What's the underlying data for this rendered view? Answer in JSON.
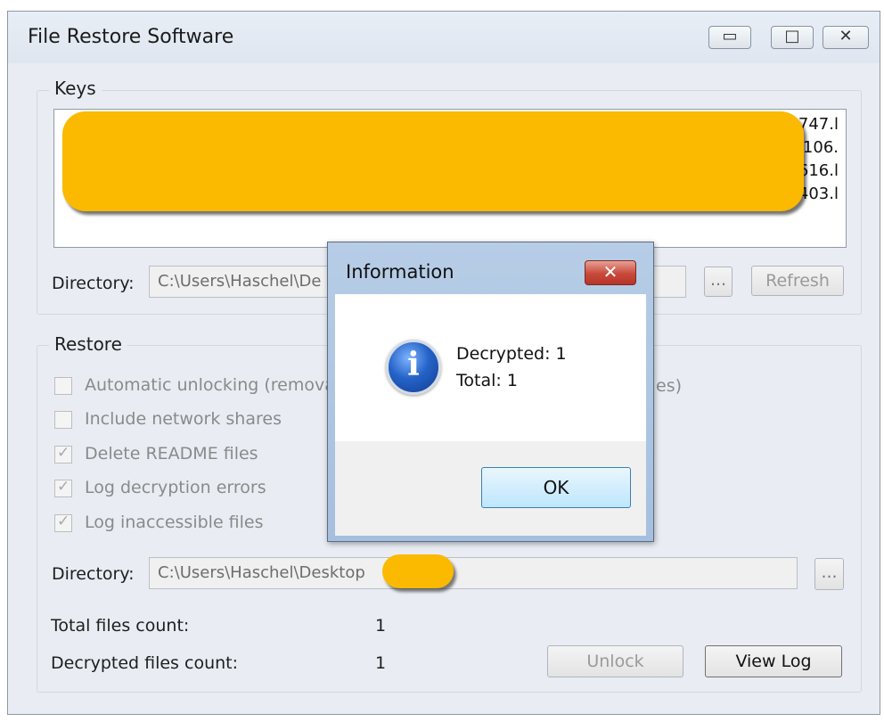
{
  "window": {
    "title": "File Restore Software",
    "minimize_glyph": "▭",
    "maximize_glyph": "□",
    "close_glyph": "✕"
  },
  "keys": {
    "legend": "Keys",
    "list_rows": [
      "747.l",
      "7106.",
      "616.l",
      "403.l"
    ],
    "directory_label": "Directory:",
    "directory_value": "C:\\Users\\Haschel\\De",
    "browse_label": "...",
    "refresh_label": "Refresh"
  },
  "restore": {
    "legend": "Restore",
    "options": [
      {
        "label": "Automatic unlocking (remova",
        "checked": false
      },
      {
        "label": "Include network shares",
        "checked": false
      },
      {
        "label": "Delete README files",
        "checked": true
      },
      {
        "label": "Log decryption errors",
        "checked": true
      },
      {
        "label": "Log inaccessible files",
        "checked": true
      }
    ],
    "option0_tail": "es)",
    "directory_label": "Directory:",
    "directory_value": "C:\\Users\\Haschel\\Desktop",
    "browse_label": "...",
    "total_label": "Total files count:",
    "total_value": "1",
    "decrypted_label": "Decrypted files count:",
    "decrypted_value": "1",
    "unlock_label": "Unlock",
    "view_log_label": "View Log"
  },
  "dialog": {
    "title": "Information",
    "close_glyph": "✕",
    "icon": "information-icon",
    "icon_glyph": "i",
    "line1": "Decrypted: 1",
    "line2": "Total: 1",
    "ok_label": "OK"
  },
  "colors": {
    "redaction": "#fbb900",
    "dialog_frame": "#a9c2e0",
    "window_bg": "#e9edf3"
  }
}
